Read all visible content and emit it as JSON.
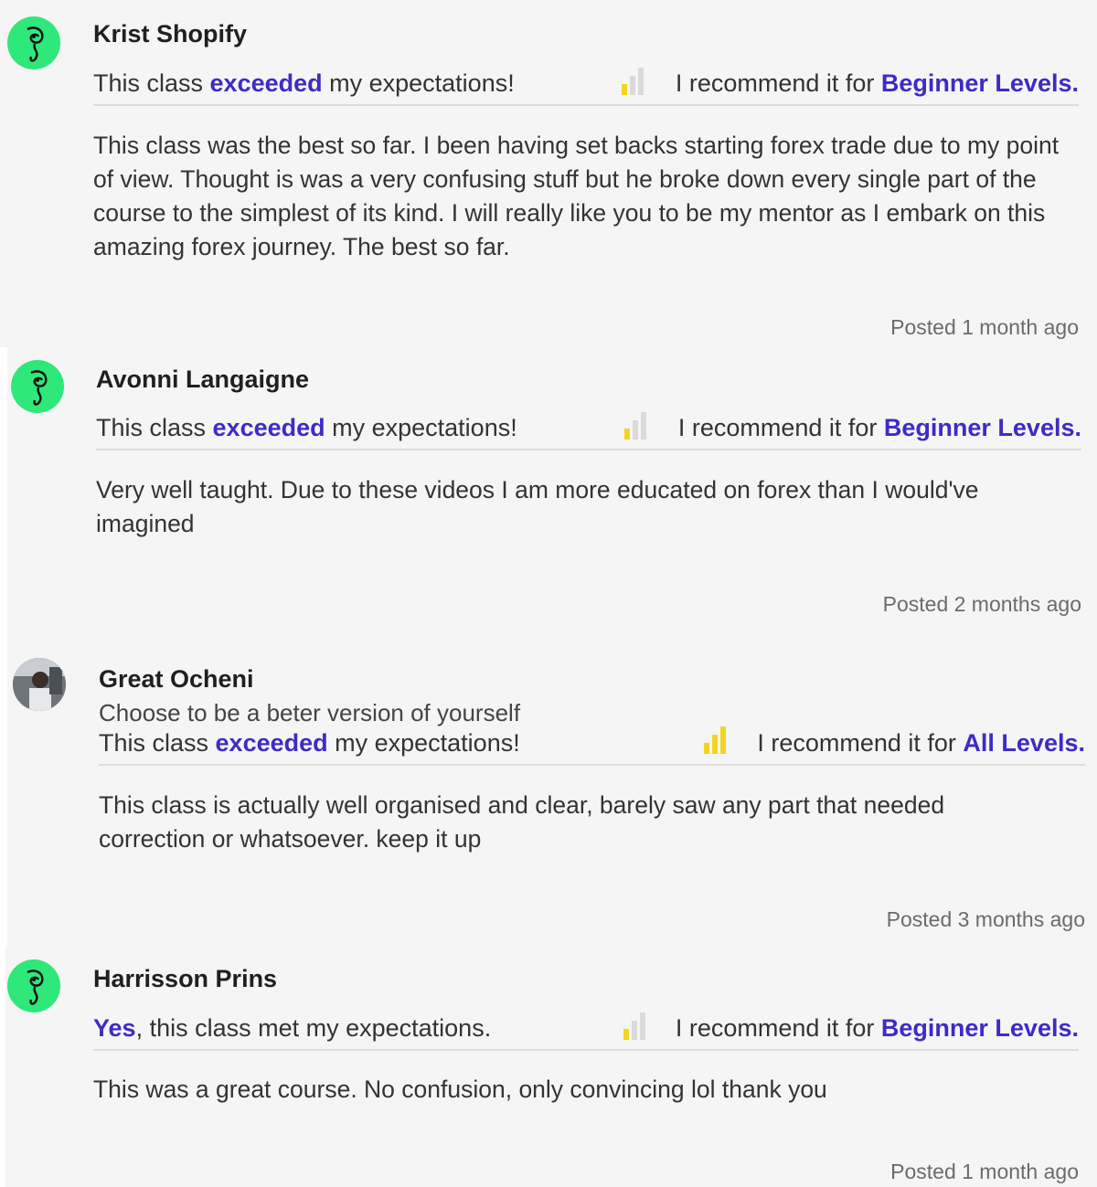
{
  "colors": {
    "accent": "#3d2bc7",
    "avatar_green": "#2ee87a",
    "bar_yellow": "#f2d51f",
    "bar_grey": "#dadada"
  },
  "reviews": [
    {
      "name": "Krist Shopify",
      "exp_pre": "This class ",
      "exp_hl": "exceeded",
      "exp_post": " my expectations!",
      "level_icon": "signal-bars-icon",
      "level_filled": 1,
      "rec_pre": "I recommend it for ",
      "rec_hl": "Beginner Levels.",
      "body": "This class was the best so far. I been having set backs starting forex trade due to my point of view. Thought is was a very confusing stuff but he broke down every single part of the course to the simplest of its kind. I will really like you to be my mentor as I embark on this amazing forex journey. The best so far.",
      "posted": "Posted 1 month ago"
    },
    {
      "name": "Avonni Langaigne",
      "exp_pre": "This class ",
      "exp_hl": "exceeded",
      "exp_post": " my expectations!",
      "level_icon": "signal-bars-icon",
      "level_filled": 1,
      "rec_pre": "I recommend it for ",
      "rec_hl": "Beginner Levels.",
      "body": "Very well taught. Due to these videos I am more educated on forex than I would've imagined",
      "posted": "Posted 2 months ago"
    },
    {
      "name": "Great Ocheni",
      "subtitle": "Choose to be a beter version of yourself",
      "exp_pre": "This class ",
      "exp_hl": "exceeded",
      "exp_post": " my expectations!",
      "level_icon": "signal-bars-icon",
      "level_filled": 3,
      "rec_pre": "I recommend it for ",
      "rec_hl": "All Levels.",
      "body": "This class is actually well organised and clear, barely saw any part that needed correction or whatsoever. keep it up",
      "posted": "Posted 3 months ago"
    },
    {
      "name": "Harrisson Prins",
      "exp_pre": "",
      "exp_hl": "Yes",
      "exp_post": ", this class met my expectations.",
      "level_icon": "signal-bars-icon",
      "level_filled": 1,
      "rec_pre": "I recommend it for ",
      "rec_hl": "Beginner Levels.",
      "body": "This was a great course. No confusion, only convincing lol thank you",
      "posted": "Posted 1 month ago"
    }
  ]
}
